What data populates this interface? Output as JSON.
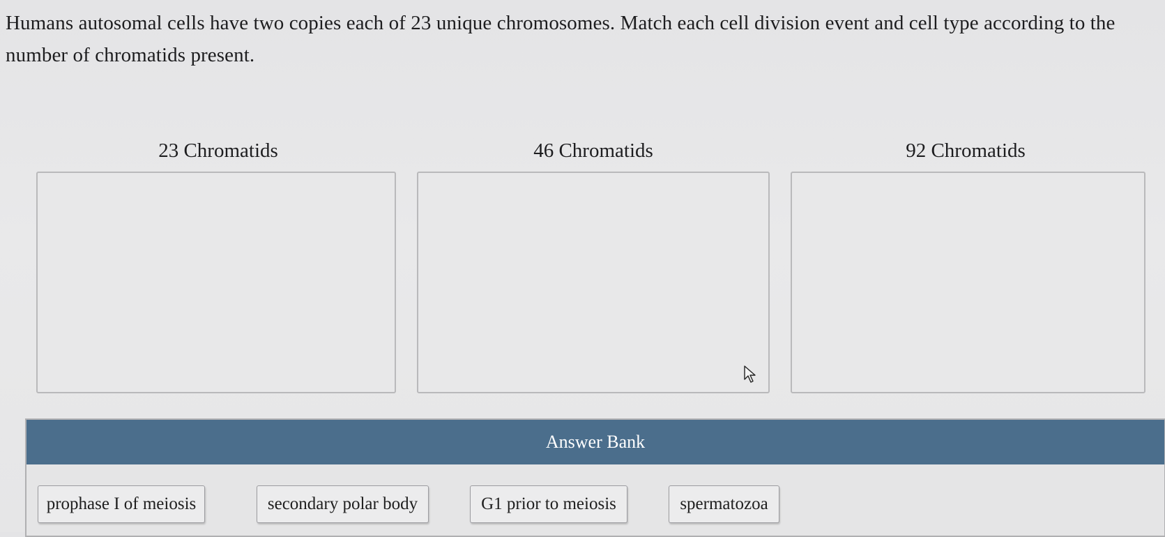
{
  "question": {
    "text": "Humans autosomal cells have two copies each of 23 unique chromosomes. Match each cell division event and cell type according to the number of chromatids present."
  },
  "dropzones": [
    {
      "label": "23 Chromatids"
    },
    {
      "label": "46 Chromatids"
    },
    {
      "label": "92 Chromatids"
    }
  ],
  "answer_bank": {
    "title": "Answer Bank",
    "items": [
      {
        "label": "prophase I of meiosis"
      },
      {
        "label": "secondary polar body"
      },
      {
        "label": "G1 prior to meiosis"
      },
      {
        "label": "spermatozoa"
      }
    ]
  },
  "colors": {
    "bank_header": "#4b6e8c",
    "background": "#e6e6e7"
  },
  "icons": {
    "cursor": "mouse-pointer-icon"
  }
}
